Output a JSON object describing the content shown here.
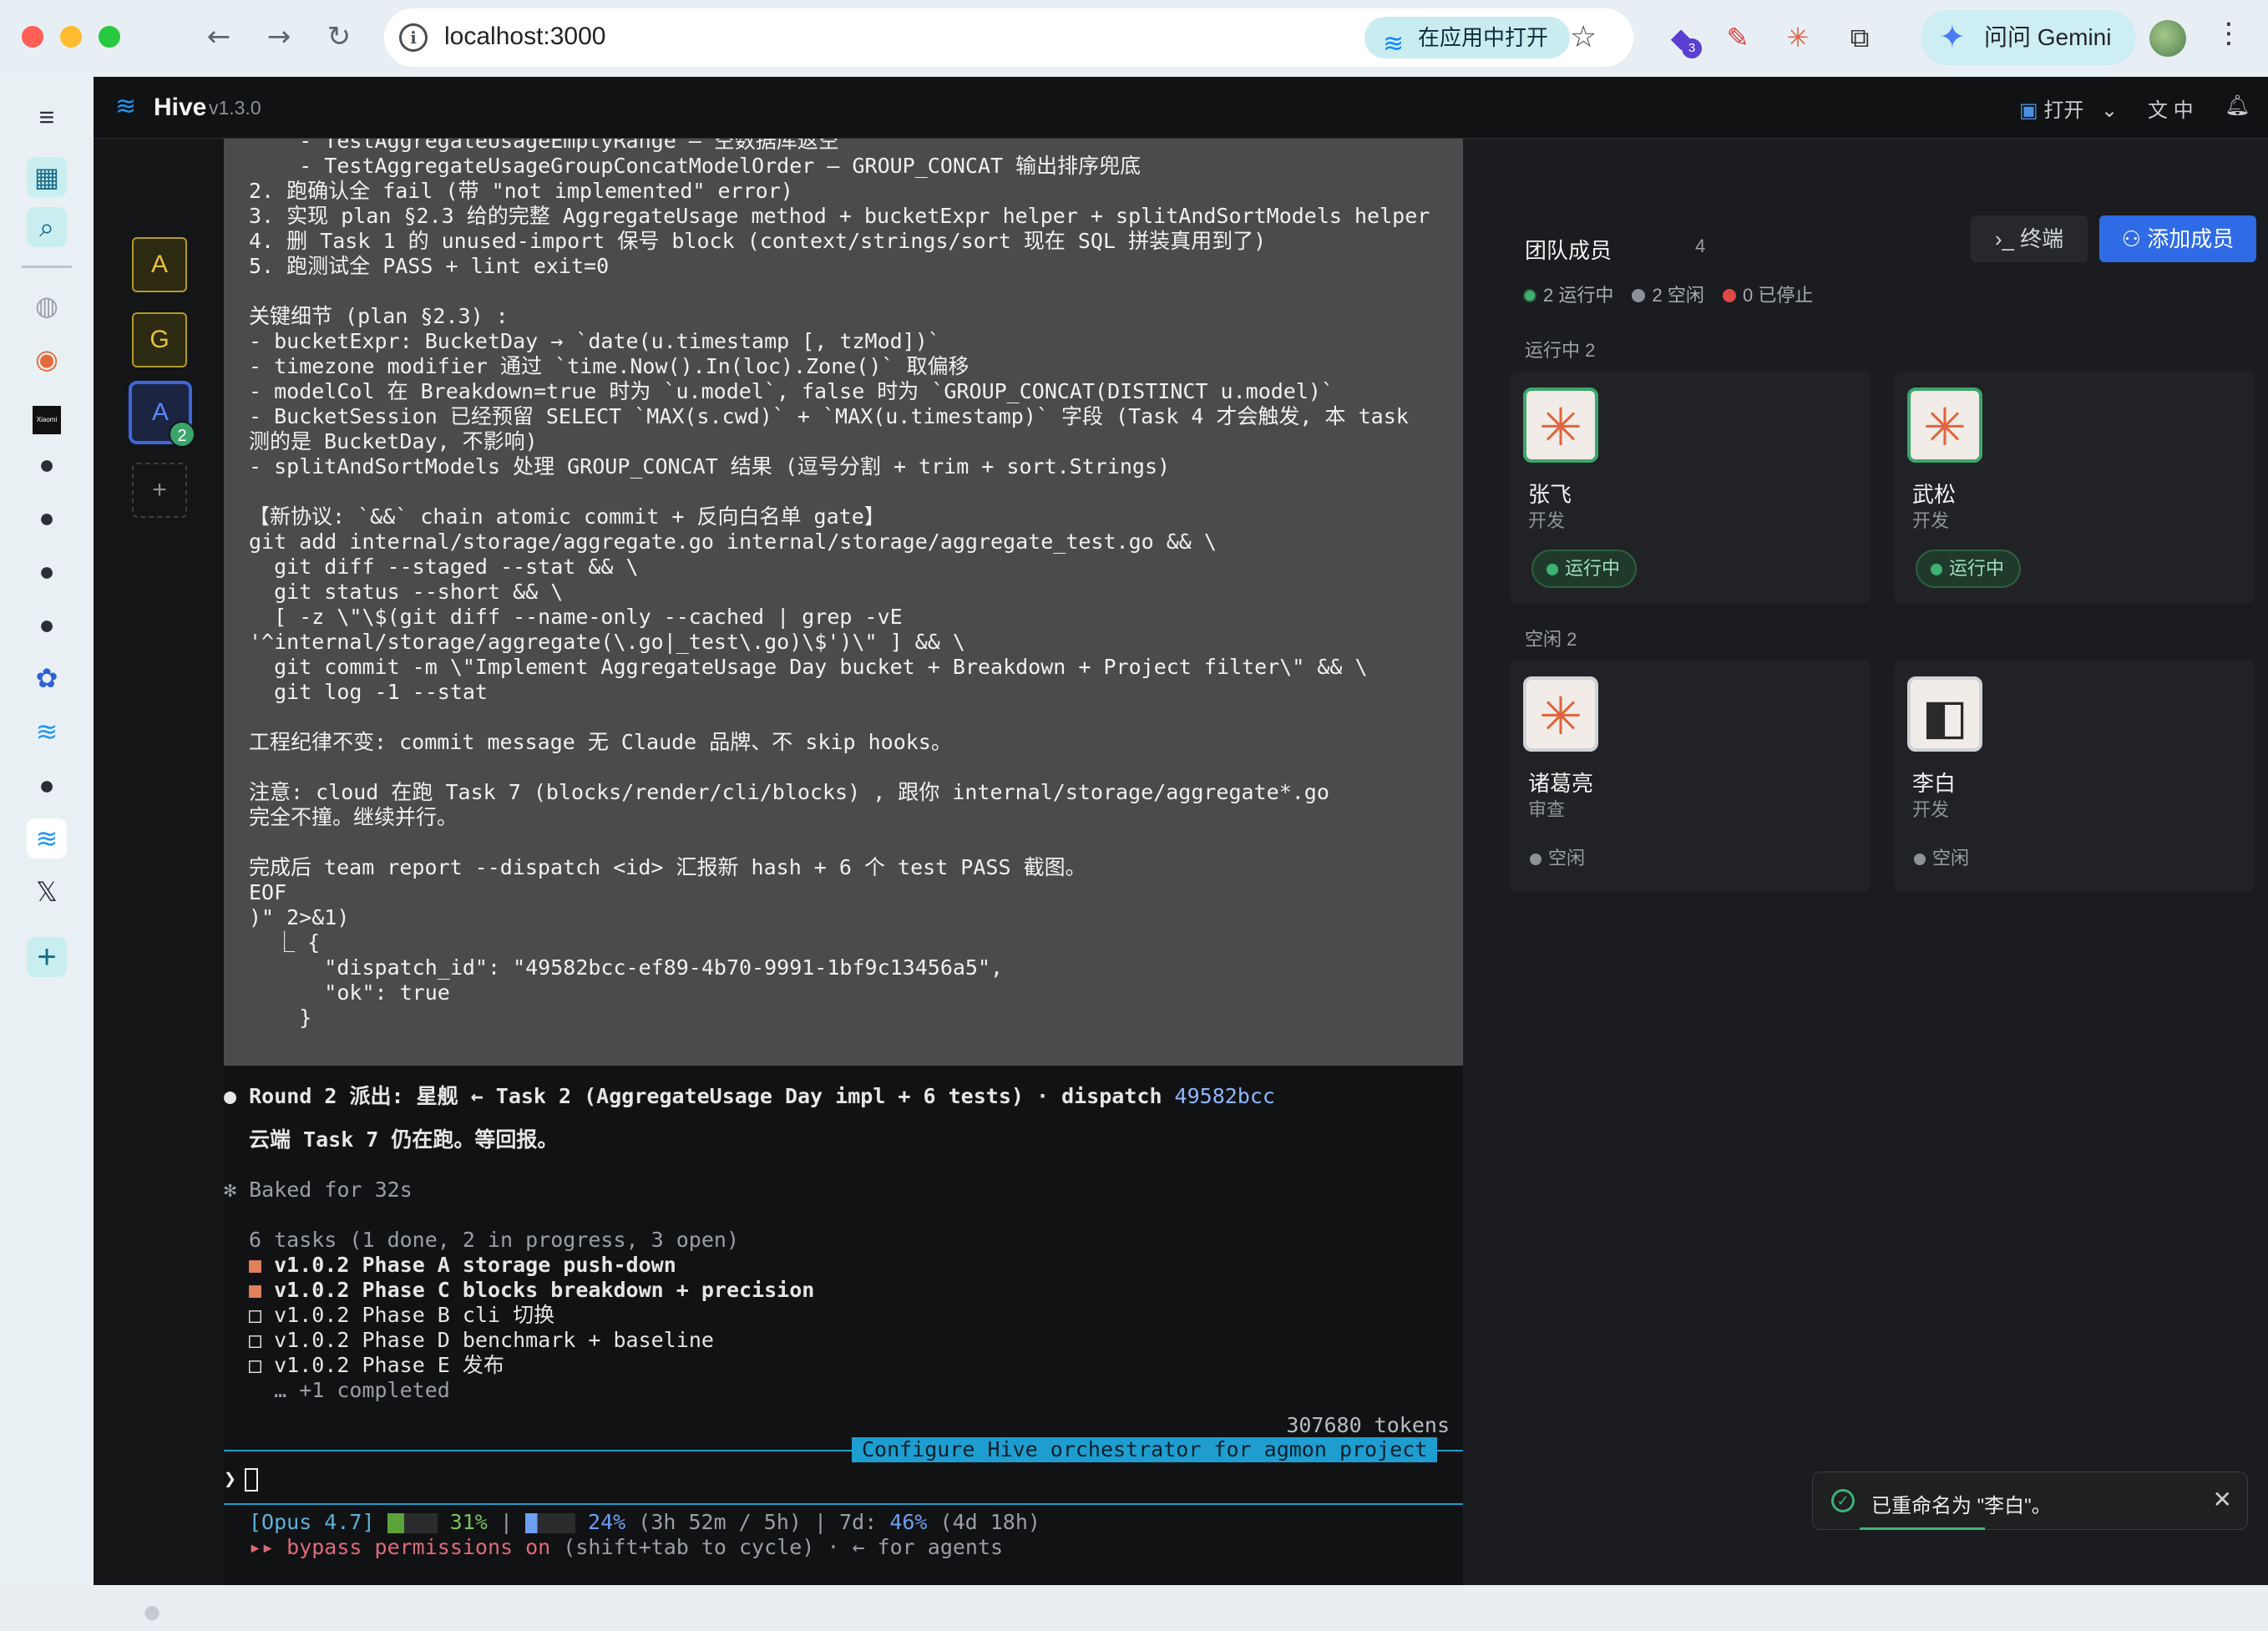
{
  "browser": {
    "url": "localhost:3000",
    "open_in_app": "在应用中打开",
    "gemini": "问问 Gemini",
    "ext_badge": "3"
  },
  "app": {
    "name": "Hive",
    "version": "v1.3.0",
    "top_open": "打开",
    "lang": "中"
  },
  "workspaces": [
    {
      "letter": "A"
    },
    {
      "letter": "G"
    },
    {
      "letter": "A",
      "badge": "2"
    }
  ],
  "terminal": {
    "block_lines": [
      "    - TestAggregateUsageEmptyRange — 空数据库返空",
      "    - TestAggregateUsageGroupConcatModelOrder — GROUP_CONCAT 输出排序兜底",
      "2. 跑确认全 fail (带 \"not implemented\" error)",
      "3. 实现 plan §2.3 给的完整 AggregateUsage method + bucketExpr helper + splitAndSortModels helper",
      "4. 删 Task 1 的 unused-import 保号 block (context/strings/sort 现在 SQL 拼装真用到了)",
      "5. 跑测试全 PASS + lint exit=0",
      "",
      "关键细节 (plan §2.3) :",
      "- bucketExpr: BucketDay → `date(u.timestamp [, tzMod])`",
      "- timezone modifier 通过 `time.Now().In(loc).Zone()` 取偏移",
      "- modelCol 在 Breakdown=true 时为 `u.model`, false 时为 `GROUP_CONCAT(DISTINCT u.model)`",
      "- BucketSession 已经预留 SELECT `MAX(s.cwd)` + `MAX(u.timestamp)` 字段 (Task 4 才会触发, 本 task",
      "测的是 BucketDay, 不影响)",
      "- splitAndSortModels 处理 GROUP_CONCAT 结果 (逗号分割 + trim + sort.Strings)",
      "",
      "【新协议: `&&` chain atomic commit + 反向白名单 gate】",
      "git add internal/storage/aggregate.go internal/storage/aggregate_test.go && \\",
      "  git diff --staged --stat && \\",
      "  git status --short && \\",
      "  [ -z \\\"\\$(git diff --name-only --cached | grep -vE",
      "'^internal/storage/aggregate(\\.go|_test\\.go)\\$')\\\" ] && \\",
      "  git commit -m \\\"Implement AggregateUsage Day bucket + Breakdown + Project filter\\\" && \\",
      "  git log -1 --stat",
      "",
      "工程纪律不变: commit message 无 Claude 品牌、不 skip hooks。",
      "",
      "注意: cloud 在跑 Task 7 (blocks/render/cli/blocks) , 跟你 internal/storage/aggregate*.go",
      "完全不撞。继续并行。",
      "",
      "完成后 team report --dispatch <id> 汇报新 hash + 6 个 test PASS 截图。",
      "EOF",
      ")\" 2>&1)",
      "  ⎿ {",
      "      \"dispatch_id\": \"49582bcc-ef89-4b70-9991-1bf9c13456a5\",",
      "      \"ok\": true",
      "    }"
    ],
    "round_line": "Round 2 派出: 星舰 ← Task 2 (AggregateUsage Day impl + 6 tests) · dispatch ",
    "round_hash": "49582bcc",
    "cloud_line": "云端 Task 7 仍在跑。等回报。",
    "baked": "✻ Baked for 32s",
    "tasks_summary": "6 tasks (1 done, 2 in progress, 3 open)",
    "tasks": [
      {
        "mark": "■",
        "label": "v1.0.2 Phase A storage push-down",
        "state": "in_progress"
      },
      {
        "mark": "■",
        "label": "v1.0.2 Phase C blocks breakdown + precision",
        "state": "in_progress"
      },
      {
        "mark": "□",
        "label": "v1.0.2 Phase B cli 切换",
        "state": "open"
      },
      {
        "mark": "□",
        "label": "v1.0.2 Phase D benchmark + baseline",
        "state": "open"
      },
      {
        "mark": "□",
        "label": "v1.0.2 Phase E 发布",
        "state": "open"
      }
    ],
    "completed_more": "  … +1 completed",
    "tokens": "307680 tokens",
    "task_title": "Configure Hive orchestrator for agmon project",
    "prompt": "❯",
    "opus_model": "[Opus 4.7]",
    "opus_ctx": "31%",
    "opus_5h": "24%",
    "opus_5h_detail": "(3h 52m / 5h)",
    "opus_7d": "46%",
    "opus_7d_detail": "(4d 18h)",
    "bypass": "▸▸ bypass permissions on",
    "bypass_hint": " (shift+tab to cycle) · ← for agents"
  },
  "team": {
    "title": "团队成员",
    "count": "4",
    "terminal_btn": "终端",
    "add_btn": "添加成员",
    "stats": [
      {
        "label": "2 运行中",
        "color": "#3fb173"
      },
      {
        "label": "2 空闲",
        "color": "#8d9299"
      },
      {
        "label": "0 已停止",
        "color": "#e04848"
      }
    ],
    "running_section": "运行中 2",
    "idle_section": "空闲 2",
    "members": [
      {
        "name": "张飞",
        "role": "开发",
        "status": "运行中"
      },
      {
        "name": "武松",
        "role": "开发",
        "status": "运行中"
      },
      {
        "name": "诸葛亮",
        "role": "审查",
        "status": "空闲"
      },
      {
        "name": "李白",
        "role": "开发",
        "status": "空闲"
      }
    ]
  },
  "toast": {
    "message": "已重命名为 \"李白\"。"
  }
}
